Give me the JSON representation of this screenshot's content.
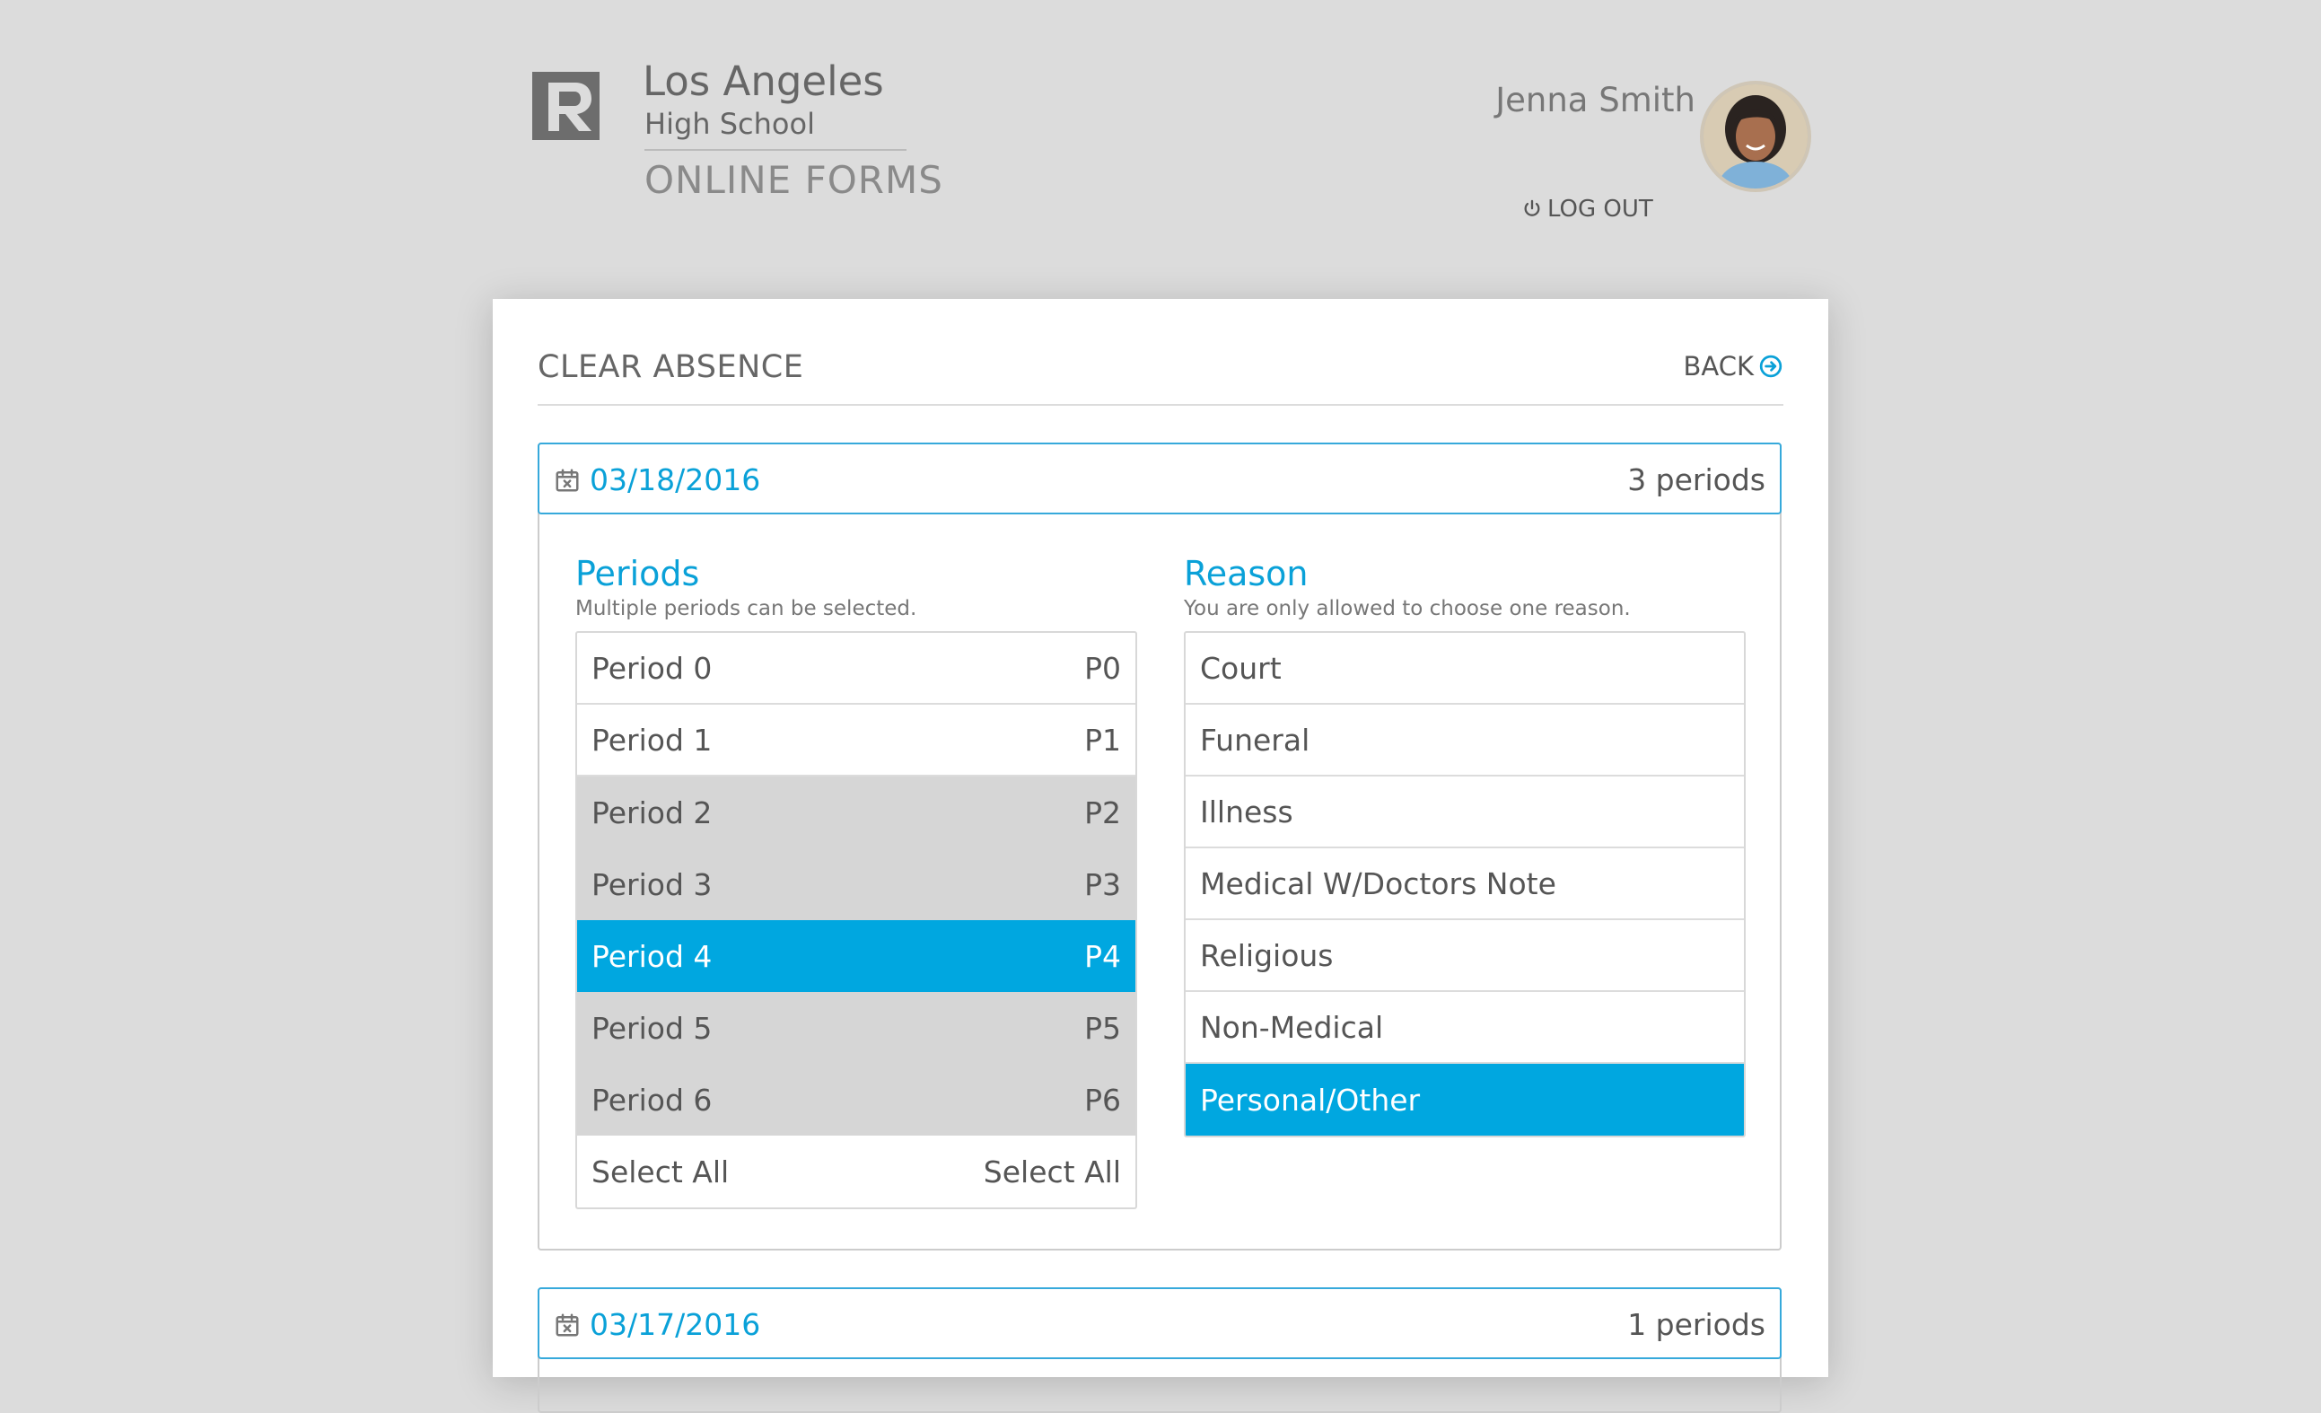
{
  "header": {
    "school_name": "Los Angeles",
    "school_sub": "High School",
    "product": "ONLINE FORMS",
    "user_name": "Jenna Smith",
    "logout_label": "LOG OUT"
  },
  "card": {
    "title": "CLEAR ABSENCE",
    "back_label": "BACK"
  },
  "days": [
    {
      "date": "03/18/2016",
      "count": "3 periods",
      "periods_title": "Periods",
      "periods_note": "Multiple periods can be selected.",
      "periods": [
        {
          "label": "Period 0",
          "code": "P0",
          "state": "normal"
        },
        {
          "label": "Period 1",
          "code": "P1",
          "state": "normal"
        },
        {
          "label": "Period 2",
          "code": "P2",
          "state": "grey"
        },
        {
          "label": "Period 3",
          "code": "P3",
          "state": "grey"
        },
        {
          "label": "Period 4",
          "code": "P4",
          "state": "selected"
        },
        {
          "label": "Period 5",
          "code": "P5",
          "state": "grey"
        },
        {
          "label": "Period 6",
          "code": "P6",
          "state": "grey"
        },
        {
          "label": "Select All",
          "code": "Select All",
          "state": "normal"
        }
      ],
      "reason_title": "Reason",
      "reason_note": "You are only allowed to choose one reason.",
      "reasons": [
        {
          "label": "Court",
          "state": "normal"
        },
        {
          "label": "Funeral",
          "state": "normal"
        },
        {
          "label": "Illness",
          "state": "normal"
        },
        {
          "label": "Medical W/Doctors Note",
          "state": "normal"
        },
        {
          "label": "Religious",
          "state": "normal"
        },
        {
          "label": "Non-Medical",
          "state": "normal"
        },
        {
          "label": "Personal/Other",
          "state": "selected"
        }
      ]
    },
    {
      "date": "03/17/2016",
      "count": "1 periods"
    }
  ],
  "colors": {
    "accent": "#00a7e0",
    "background": "#dcdcdc",
    "disabled_row": "#d6d6d6"
  },
  "icons": {
    "logo": "school-logo-icon",
    "logout": "power-icon",
    "back": "arrow-circle-right-icon",
    "date": "calendar-x-icon"
  }
}
